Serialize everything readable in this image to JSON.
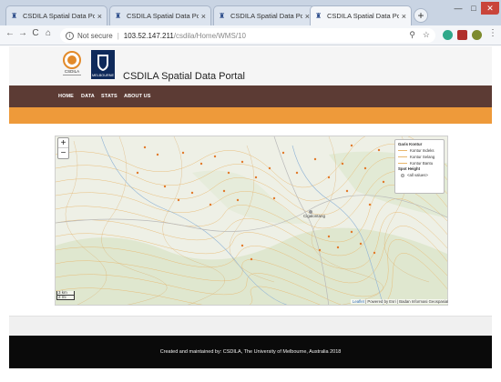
{
  "browser": {
    "tabs": [
      {
        "title": "CSDILA Spatial Data Portal",
        "close": "×"
      },
      {
        "title": "CSDILA Spatial Data Portal",
        "close": "×"
      },
      {
        "title": "CSDILA Spatial Data Portal",
        "close": "×"
      },
      {
        "title": "CSDILA Spatial Data Portal",
        "close": "×"
      }
    ],
    "new_tab": "+",
    "window": {
      "min": "—",
      "max": "□",
      "close": "✕"
    },
    "nav": {
      "back": "←",
      "forward": "→",
      "reload": "C",
      "home": "⌂"
    },
    "address": {
      "security": "Not secure",
      "host": "103.52.147.211",
      "path": "/csdila/Home/WMS/10"
    }
  },
  "header": {
    "brand": "CSDILA Spatial Data Portal",
    "logo1_text": "CSDILA",
    "logo2_text": "MELBOURNE"
  },
  "nav": {
    "items": [
      "HOME",
      "DATA",
      "STATS",
      "ABOUT US"
    ]
  },
  "map": {
    "zoom_in": "+",
    "zoom_out": "−",
    "place_label": "Cigalontang",
    "legend": {
      "title1": "Garis Kontur",
      "rows1": [
        "Kontur Indeks",
        "Kontur Selang",
        "Kontur Bantu"
      ],
      "title2": "Spot Height",
      "rows2": [
        "<all values>"
      ]
    },
    "scale": {
      "metric": "3 km",
      "imperial": "2 mi"
    },
    "attribution": {
      "leaflet": "Leaflet",
      "rest": " | Powered by Esri | Badan Informasi Geospasial"
    }
  },
  "footer": {
    "text": "Created and maintained by: CSDILA, The University of Melbourne, Australia 2018"
  },
  "colors": {
    "navbar": "#5c3b34",
    "accent_bar": "#ee9a3a",
    "footer": "#0a0a0a"
  }
}
